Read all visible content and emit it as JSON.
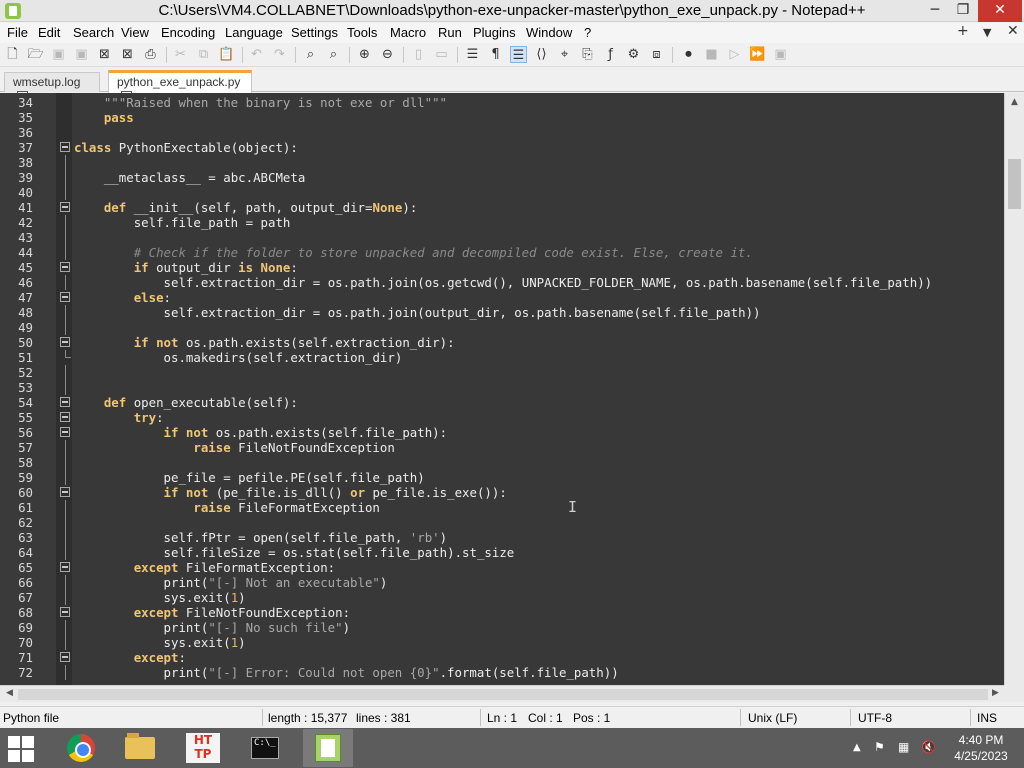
{
  "window": {
    "title": "C:\\Users\\VM4.COLLABNET\\Downloads\\python-exe-unpacker-master\\python_exe_unpack.py - Notepad++",
    "minimize": "─",
    "maximize": "❐",
    "close": "✕"
  },
  "menu": {
    "items": [
      "File",
      "Edit",
      "Search",
      "View",
      "Encoding",
      "Language",
      "Settings",
      "Tools",
      "Macro",
      "Run",
      "Plugins",
      "Window",
      "?"
    ],
    "plus": "+",
    "down": "▼",
    "close": "✕"
  },
  "tabs": [
    {
      "label": "wmsetup.log",
      "active": false
    },
    {
      "label": "python_exe_unpack.py",
      "active": true
    }
  ],
  "tab_close_glyph": "x",
  "editor": {
    "lines": [
      {
        "n": "34",
        "t": "    \"\"\"Raised when the binary is not exe or dll\"\"\""
      },
      {
        "n": "35",
        "t": "    pass"
      },
      {
        "n": "36",
        "t": ""
      },
      {
        "n": "37",
        "t": "class PythonExectable(object):"
      },
      {
        "n": "38",
        "t": ""
      },
      {
        "n": "39",
        "t": "    __metaclass__ = abc.ABCMeta"
      },
      {
        "n": "40",
        "t": ""
      },
      {
        "n": "41",
        "t": "    def __init__(self, path, output_dir=None):"
      },
      {
        "n": "42",
        "t": "        self.file_path = path"
      },
      {
        "n": "43",
        "t": ""
      },
      {
        "n": "44",
        "t": "        # Check if the folder to store unpacked and decompiled code exist. Else, create it."
      },
      {
        "n": "45",
        "t": "        if output_dir is None:"
      },
      {
        "n": "46",
        "t": "            self.extraction_dir = os.path.join(os.getcwd(), UNPACKED_FOLDER_NAME, os.path.basename(self.file_path))"
      },
      {
        "n": "47",
        "t": "        else:"
      },
      {
        "n": "48",
        "t": "            self.extraction_dir = os.path.join(output_dir, os.path.basename(self.file_path))"
      },
      {
        "n": "49",
        "t": ""
      },
      {
        "n": "50",
        "t": "        if not os.path.exists(self.extraction_dir):"
      },
      {
        "n": "51",
        "t": "            os.makedirs(self.extraction_dir)"
      },
      {
        "n": "52",
        "t": ""
      },
      {
        "n": "53",
        "t": ""
      },
      {
        "n": "54",
        "t": "    def open_executable(self):"
      },
      {
        "n": "55",
        "t": "        try:"
      },
      {
        "n": "56",
        "t": "            if not os.path.exists(self.file_path):"
      },
      {
        "n": "57",
        "t": "                raise FileNotFoundException"
      },
      {
        "n": "58",
        "t": ""
      },
      {
        "n": "59",
        "t": "            pe_file = pefile.PE(self.file_path)"
      },
      {
        "n": "60",
        "t": "            if not (pe_file.is_dll() or pe_file.is_exe()):"
      },
      {
        "n": "61",
        "t": "                raise FileFormatException"
      },
      {
        "n": "62",
        "t": ""
      },
      {
        "n": "63",
        "t": "            self.fPtr = open(self.file_path, 'rb')"
      },
      {
        "n": "64",
        "t": "            self.fileSize = os.stat(self.file_path).st_size"
      },
      {
        "n": "65",
        "t": "        except FileFormatException:"
      },
      {
        "n": "66",
        "t": "            print(\"[-] Not an executable\")"
      },
      {
        "n": "67",
        "t": "            sys.exit(1)"
      },
      {
        "n": "68",
        "t": "        except FileNotFoundException:"
      },
      {
        "n": "69",
        "t": "            print(\"[-] No such file\")"
      },
      {
        "n": "70",
        "t": "            sys.exit(1)"
      },
      {
        "n": "71",
        "t": "        except:"
      },
      {
        "n": "72",
        "t": "            print(\"[-] Error: Could not open {0}\".format(self.file_path))"
      }
    ]
  },
  "statusbar": {
    "filetype": "Python file",
    "length": "length : 15,377",
    "lines": "lines : 381",
    "ln": "Ln : 1",
    "col": "Col : 1",
    "pos": "Pos : 1",
    "eol": "Unix (LF)",
    "encoding": "UTF-8",
    "mode": "INS"
  },
  "taskbar": {
    "time": "4:40 PM",
    "date": "4/25/2023",
    "http_label": "HT TP",
    "cmd_label": "C:\\_"
  },
  "colors": {
    "editor_bg": "#383838",
    "keyword": "#f0c674",
    "tab_accent": "#f2a33a",
    "taskbar": "#5c5c5c"
  }
}
